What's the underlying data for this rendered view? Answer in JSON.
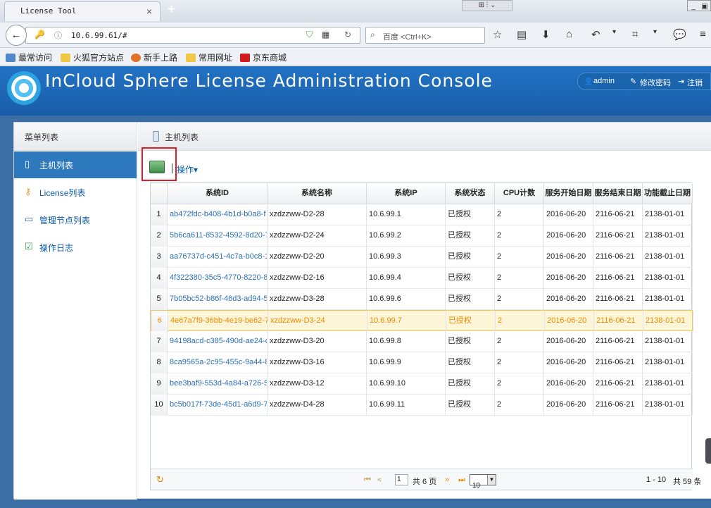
{
  "browser": {
    "tab_title": "License Tool",
    "tab_close": "×",
    "new_tab": "+",
    "url": "10.6.99.61/#",
    "search_placeholder": "百度 <Ctrl+K>",
    "window_controls": "⊞ ⫶ ⌄",
    "bookmarks": [
      "最常访问",
      "火狐官方站点",
      "新手上路",
      "常用网址",
      "京东商城"
    ]
  },
  "app": {
    "title": "InCloud Sphere License Administration Console",
    "user": "admin",
    "change_password": "修改密码",
    "logout": "注销"
  },
  "sidebar": {
    "title": "菜单列表",
    "items": [
      {
        "label": "主机列表",
        "active": true,
        "icon": "host-icon"
      },
      {
        "label": "License列表",
        "active": false,
        "icon": "key-icon"
      },
      {
        "label": "管理节点列表",
        "active": false,
        "icon": "monitor-icon"
      },
      {
        "label": "操作日志",
        "active": false,
        "icon": "clipboard-icon"
      }
    ]
  },
  "main": {
    "title": "主机列表",
    "operations_label": "操作▾"
  },
  "table": {
    "columns": [
      "系统ID",
      "系统名称",
      "系统IP",
      "系统状态",
      "CPU计数",
      "服务开始日期",
      "服务结束日期",
      "功能截止日期"
    ],
    "rows": [
      {
        "n": "1",
        "id": "ab472fdc-b408-4b1d-b0a8-f",
        "name": "xzdzzww-D2-28",
        "ip": "10.6.99.1",
        "status": "已授权",
        "cpu": "2",
        "start": "2016-06-20",
        "end": "2116-06-21",
        "feature": "2138-01-01"
      },
      {
        "n": "2",
        "id": "5b6ca611-8532-4592-8d20-7",
        "name": "xzdzzww-D2-24",
        "ip": "10.6.99.2",
        "status": "已授权",
        "cpu": "2",
        "start": "2016-06-20",
        "end": "2116-06-21",
        "feature": "2138-01-01"
      },
      {
        "n": "3",
        "id": "aa76737d-c451-4c7a-b0c8-1",
        "name": "xzdzzww-D2-20",
        "ip": "10.6.99.3",
        "status": "已授权",
        "cpu": "2",
        "start": "2016-06-20",
        "end": "2116-06-21",
        "feature": "2138-01-01"
      },
      {
        "n": "4",
        "id": "4f322380-35c5-4770-8220-8",
        "name": "xzdzzww-D2-16",
        "ip": "10.6.99.4",
        "status": "已授权",
        "cpu": "2",
        "start": "2016-06-20",
        "end": "2116-06-21",
        "feature": "2138-01-01"
      },
      {
        "n": "5",
        "id": "7b05bc52-b86f-46d3-ad94-5",
        "name": "xzdzzww-D3-28",
        "ip": "10.6.99.6",
        "status": "已授权",
        "cpu": "2",
        "start": "2016-06-20",
        "end": "2116-06-21",
        "feature": "2138-01-01"
      },
      {
        "n": "6",
        "id": "4e67a7f9-36bb-4e19-be62-7",
        "name": "xzdzzww-D3-24",
        "ip": "10.6.99.7",
        "status": "已授权",
        "cpu": "2",
        "start": "2016-06-20",
        "end": "2116-06-21",
        "feature": "2138-01-01"
      },
      {
        "n": "7",
        "id": "94198acd-c385-490d-ae24-c",
        "name": "xzdzzww-D3-20",
        "ip": "10.6.99.8",
        "status": "已授权",
        "cpu": "2",
        "start": "2016-06-20",
        "end": "2116-06-21",
        "feature": "2138-01-01"
      },
      {
        "n": "8",
        "id": "8ca9565a-2c95-455c-9a44-8",
        "name": "xzdzzww-D3-16",
        "ip": "10.6.99.9",
        "status": "已授权",
        "cpu": "2",
        "start": "2016-06-20",
        "end": "2116-06-21",
        "feature": "2138-01-01"
      },
      {
        "n": "9",
        "id": "bee3baf9-553d-4a84-a726-5",
        "name": "xzdzzww-D3-12",
        "ip": "10.6.99.10",
        "status": "已授权",
        "cpu": "2",
        "start": "2016-06-20",
        "end": "2116-06-21",
        "feature": "2138-01-01"
      },
      {
        "n": "10",
        "id": "bc5b017f-73de-45d1-a6d9-7",
        "name": "xzdzzww-D4-28",
        "ip": "10.6.99.11",
        "status": "已授权",
        "cpu": "2",
        "start": "2016-06-20",
        "end": "2116-06-21",
        "feature": "2138-01-01"
      }
    ],
    "highlighted_row": 6
  },
  "pager": {
    "current_page": "1",
    "total_pages_label": "共 6 页",
    "page_size": "10",
    "range_label": "1 - 10",
    "total_label": "共 59 条"
  },
  "colors": {
    "header_blue": "#2272c4",
    "active_blue": "#2e79bd",
    "highlight_text": "#ef8a00",
    "red_box": "#df1f26"
  }
}
